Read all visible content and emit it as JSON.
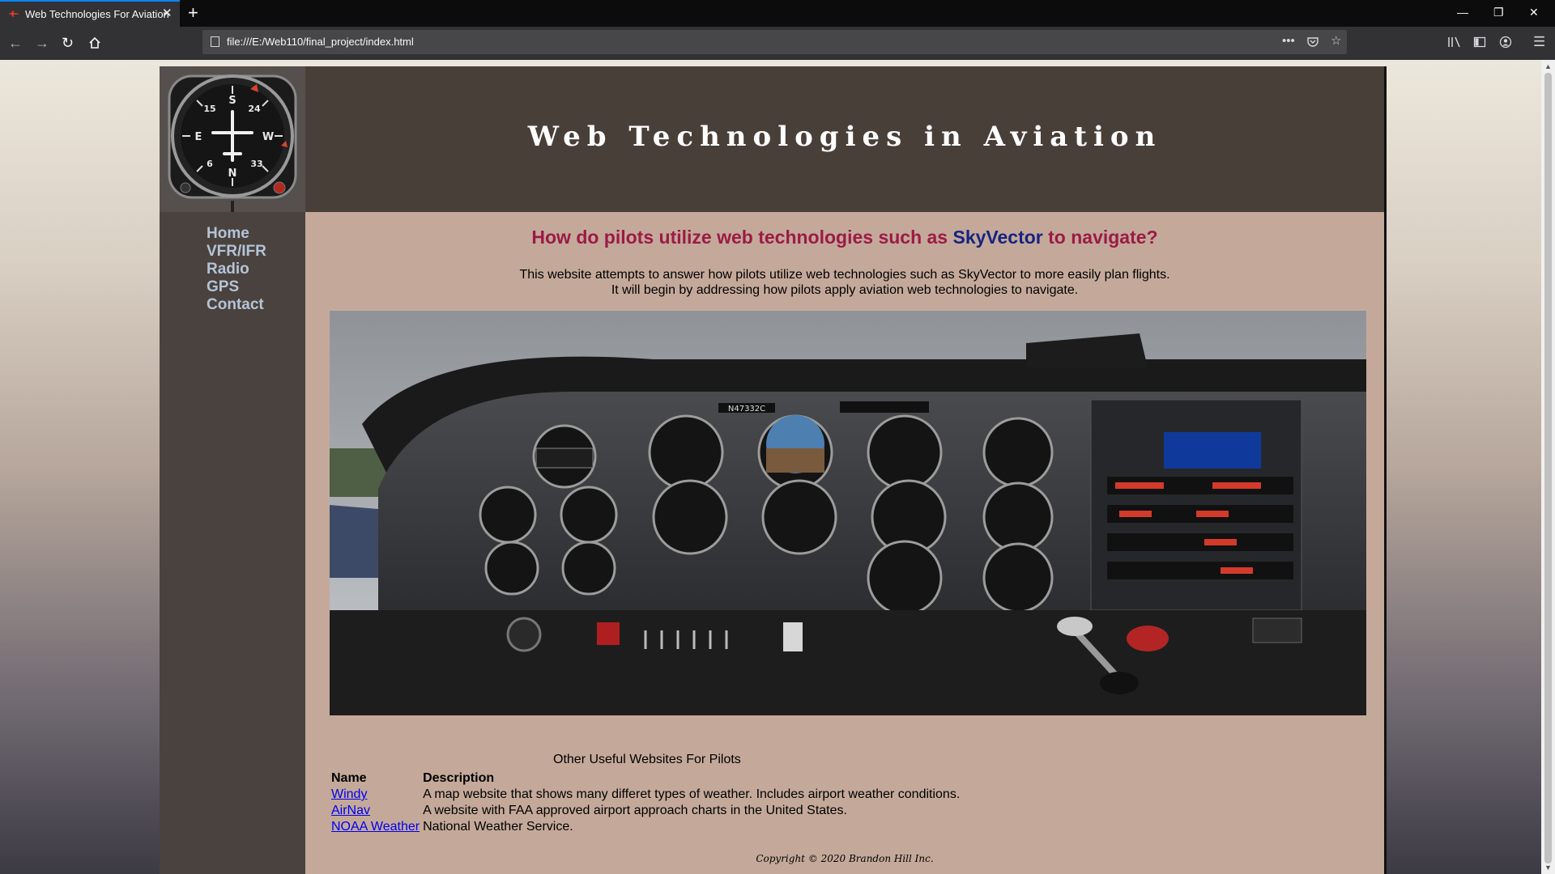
{
  "browser": {
    "tab_title": "Web Technologies For Aviation",
    "tab_close": "✕",
    "new_tab": "+",
    "url": "file:///E:/Web110/final_project/index.html",
    "page_actions": "•••",
    "window_controls": {
      "minimize": "—",
      "restore": "❐",
      "close": "✕"
    }
  },
  "site": {
    "title": "Web Technologies in Aviation",
    "nav": [
      "Home",
      "VFR/IFR",
      "Radio",
      "GPS",
      "Contact"
    ],
    "headline": {
      "before": "How do pilots utilize web technologies such as ",
      "highlight": "SkyVector",
      "after": " to navigate?"
    },
    "intro": [
      "This website attempts to answer how pilots utilize web technologies such as SkyVector to more easily plan flights.",
      "It will begin by addressing how pilots apply aviation web technologies to navigate."
    ],
    "cockpit_registration": "N47332C",
    "links_table": {
      "caption": "Other Useful Websites For Pilots",
      "headers": [
        "Name",
        "Description"
      ],
      "rows": [
        {
          "name": "Windy",
          "description": "A map website that shows many differet types of weather. Includes airport weather conditions."
        },
        {
          "name": "AirNav",
          "description": "A website with FAA approved airport approach charts in the United States."
        },
        {
          "name": "NOAA Weather",
          "description": "National Weather Service."
        }
      ]
    },
    "copyright": "Copyright © 2020 Brandon Hill Inc."
  },
  "colors": {
    "header_bg": "#493f39",
    "sidebar_bg": "#4a423e",
    "content_bg": "#c4a99a",
    "headline": "#9b1b45",
    "skyvector": "#17237f",
    "nav_link": "#b4c4d7",
    "link": "#0000ee"
  }
}
